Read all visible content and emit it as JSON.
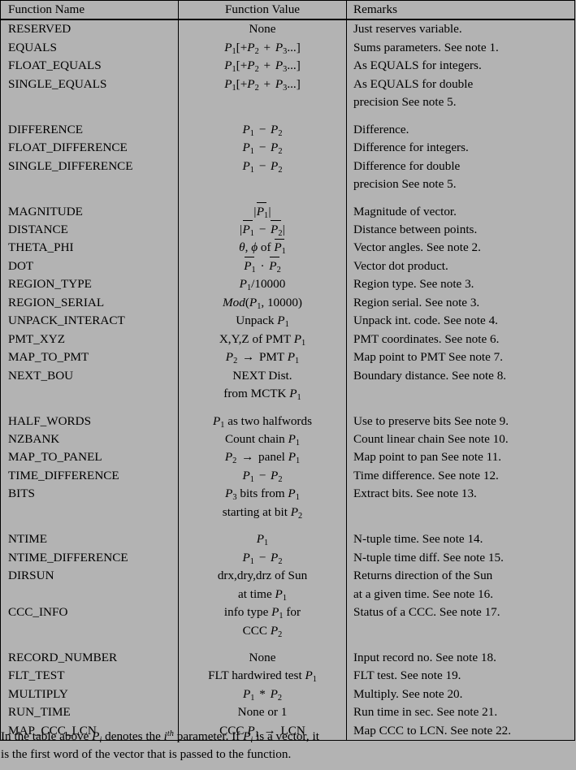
{
  "table": {
    "headers": {
      "name": "Function Name",
      "value": "Function Value",
      "remarks": "Remarks"
    },
    "groups": [
      {
        "rows": [
          {
            "name": "RESERVED",
            "value_html": "None",
            "remarks": "Just reserves variable."
          },
          {
            "name": "EQUALS",
            "value_html": "<span class=\"mi\">P</span><sub>1</sub>[+<span class=\"mi\">P</span><sub>2</sub> <span class=\"op\">+</span> <span class=\"mi\">P</span><sub>3</sub>...]",
            "remarks": "Sums parameters. See note 1."
          },
          {
            "name": "FLOAT_EQUALS",
            "value_html": "<span class=\"mi\">P</span><sub>1</sub>[+<span class=\"mi\">P</span><sub>2</sub> <span class=\"op\">+</span> <span class=\"mi\">P</span><sub>3</sub>...]",
            "remarks": "As EQUALS for integers."
          },
          {
            "name": "SINGLE_EQUALS",
            "value_html": "<span class=\"mi\">P</span><sub>1</sub>[+<span class=\"mi\">P</span><sub>2</sub> <span class=\"op\">+</span> <span class=\"mi\">P</span><sub>3</sub>...]",
            "remarks": "As EQUALS for double"
          },
          {
            "name": "",
            "value_html": "",
            "remarks": "precision See note 5."
          }
        ]
      },
      {
        "rows": [
          {
            "name": "DIFFERENCE",
            "value_html": "<span class=\"mi\">P</span><sub>1</sub> <span class=\"op\">&#8722;</span> <span class=\"mi\">P</span><sub>2</sub>",
            "remarks": "Difference."
          },
          {
            "name": "FLOAT_DIFFERENCE",
            "value_html": "<span class=\"mi\">P</span><sub>1</sub> <span class=\"op\">&#8722;</span> <span class=\"mi\">P</span><sub>2</sub>",
            "remarks": "Difference for integers."
          },
          {
            "name": "SINGLE_DIFFERENCE",
            "value_html": "<span class=\"mi\">P</span><sub>1</sub> <span class=\"op\">&#8722;</span> <span class=\"mi\">P</span><sub>2</sub>",
            "remarks": "Difference for double"
          },
          {
            "name": "",
            "value_html": "",
            "remarks": "precision See note 5."
          }
        ]
      },
      {
        "rows": [
          {
            "name": "MAGNITUDE",
            "value_html": "<span class=\"abs\">|</span><span class=\"vec\"><span class=\"bar\"></span><span class=\"mi\">P</span><sub>1</sub></span><span class=\"abs\">|</span>",
            "remarks": "Magnitude of vector."
          },
          {
            "name": "DISTANCE",
            "value_html": "<span class=\"abs\">|</span><span class=\"vec\"><span class=\"bar\"></span><span class=\"mi\">P</span><sub>1</sub></span> <span class=\"op\">&#8722;</span> <span class=\"vec\"><span class=\"bar\"></span><span class=\"mi\">P</span><sub>2</sub></span><span class=\"abs\">|</span>",
            "remarks": "Distance between points."
          },
          {
            "name": "THETA_PHI",
            "value_html": "<span class=\"mi\">&#952;</span>, <span class=\"mi\">&#981;</span> <span class=\"mup\">of</span> <span class=\"vec\"><span class=\"bar\"></span><span class=\"mi\">P</span><sub>1</sub></span>",
            "remarks": "Vector angles. See note 2."
          },
          {
            "name": "DOT",
            "value_html": "<span class=\"vec\"><span class=\"bar\"></span><span class=\"mi\">P</span><sub>1</sub></span> <span class=\"op\">&#183;</span> <span class=\"vec\"><span class=\"bar\"></span><span class=\"mi\">P</span><sub>2</sub></span>",
            "remarks": "Vector dot product."
          },
          {
            "name": "REGION_TYPE",
            "value_html": "<span class=\"mi\">P</span><sub>1</sub>/10000",
            "remarks": "Region type. See note 3."
          },
          {
            "name": "REGION_SERIAL",
            "value_html": "<span class=\"mi\">Mod</span>(<span class=\"mi\">P</span><sub>1</sub>, 10000)",
            "remarks": "Region serial. See note 3."
          },
          {
            "name": "UNPACK_INTERACT",
            "value_html": "Unpack <span class=\"mi\">P</span><sub>1</sub>",
            "remarks": "Unpack int. code. See note 4."
          },
          {
            "name": "PMT_XYZ",
            "value_html": "X,Y,Z of PMT <span class=\"mi\">P</span><sub>1</sub>",
            "remarks": "PMT coordinates. See note 6."
          },
          {
            "name": "MAP_TO_PMT",
            "value_html": "<span class=\"mi\">P</span><sub>2</sub> <span class=\"op\">&#8594;</span> PMT <span class=\"mi\">P</span><sub>1</sub>",
            "remarks": "Map point to PMT See note 7."
          },
          {
            "name": "NEXT_BOU",
            "value_html": "NEXT Dist.",
            "remarks": "Boundary distance. See note 8."
          },
          {
            "name": "",
            "value_html": "from MCTK <span class=\"mi\">P</span><sub>1</sub>",
            "remarks": ""
          }
        ]
      },
      {
        "rows": [
          {
            "name": "HALF_WORDS",
            "value_html": "<span class=\"mi\">P</span><sub>1</sub> as two halfwords",
            "remarks": "Use to preserve bits See note 9."
          },
          {
            "name": "NZBANK",
            "value_html": "Count chain <span class=\"mi\">P</span><sub>1</sub>",
            "remarks": "Count linear chain See note 10."
          },
          {
            "name": "MAP_TO_PANEL",
            "value_html": "<span class=\"mi\">P</span><sub>2</sub> <span class=\"op\">&#8594;</span> panel <span class=\"mi\">P</span><sub>1</sub>",
            "remarks": "Map point to pan See note 11."
          },
          {
            "name": "TIME_DIFFERENCE",
            "value_html": "<span class=\"mi\">P</span><sub>1</sub> <span class=\"op\">&#8722;</span> <span class=\"mi\">P</span><sub>2</sub>",
            "remarks": "Time difference. See note 12."
          },
          {
            "name": "BITS",
            "value_html": "<span class=\"mi\">P</span><sub>3</sub> bits from <span class=\"mi\">P</span><sub>1</sub>",
            "remarks": "Extract bits. See note 13."
          },
          {
            "name": "",
            "value_html": "starting at bit <span class=\"mi\">P</span><sub>2</sub>",
            "remarks": ""
          }
        ]
      },
      {
        "rows": [
          {
            "name": "NTIME",
            "value_html": "<span class=\"mi\">P</span><sub>1</sub>",
            "remarks": "N-tuple time. See note 14."
          },
          {
            "name": "NTIME_DIFFERENCE",
            "value_html": "<span class=\"mi\">P</span><sub>1</sub> <span class=\"op\">&#8722;</span> <span class=\"mi\">P</span><sub>2</sub>",
            "remarks": "N-tuple time diff. See note 15."
          },
          {
            "name": "DIRSUN",
            "value_html": "drx,dry,drz of Sun",
            "remarks": "Returns direction of the Sun"
          },
          {
            "name": "",
            "value_html": "at time <span class=\"mi\">P</span><sub>1</sub>",
            "remarks": "at a given time. See note 16."
          },
          {
            "name": "CCC_INFO",
            "value_html": "info type <span class=\"mi\">P</span><sub>1</sub> for",
            "remarks": "Status of a CCC. See note 17."
          },
          {
            "name": "",
            "value_html": "CCC <span class=\"mi\">P</span><sub>2</sub>",
            "remarks": ""
          }
        ]
      },
      {
        "rows": [
          {
            "name": "RECORD_NUMBER",
            "value_html": "None",
            "remarks": "Input record no. See note 18."
          },
          {
            "name": "FLT_TEST",
            "value_html": "FLT hardwired test <span class=\"mi\">P</span><sub>1</sub>",
            "remarks": "FLT test. See note 19."
          },
          {
            "name": "MULTIPLY",
            "value_html": "<span class=\"mi\">P</span><sub>1</sub> <span class=\"op\">*</span> <span class=\"mi\">P</span><sub>2</sub>",
            "remarks": "Multiply. See note 20."
          },
          {
            "name": "RUN_TIME",
            "value_html": "None or 1",
            "remarks": "Run time in sec. See note 21."
          },
          {
            "name": "MAP_CCC_LCN",
            "value_html": "CCC <span class=\"mi\">P</span><sub>1</sub> <span class=\"op\">&#8594;</span> LCN",
            "remarks": "Map CCC to LCN. See note 22."
          }
        ]
      }
    ]
  },
  "footer": {
    "line1_html": "In the table above <span class=\"mi\">P</span><sub><span class=\"mi\">i</span></sub> denotes the <span class=\"mi\">i</span><sup><span class=\"mi\">th</span></sup> parameter. If <span class=\"mi\">P</span><sub><span class=\"mi\">i</span></sub> is a vector, it",
    "line2_html": "is the first word of the vector that is passed to the function."
  },
  "colors": {
    "background": "#b3b3b3",
    "text": "#000000",
    "rule": "#000000"
  }
}
